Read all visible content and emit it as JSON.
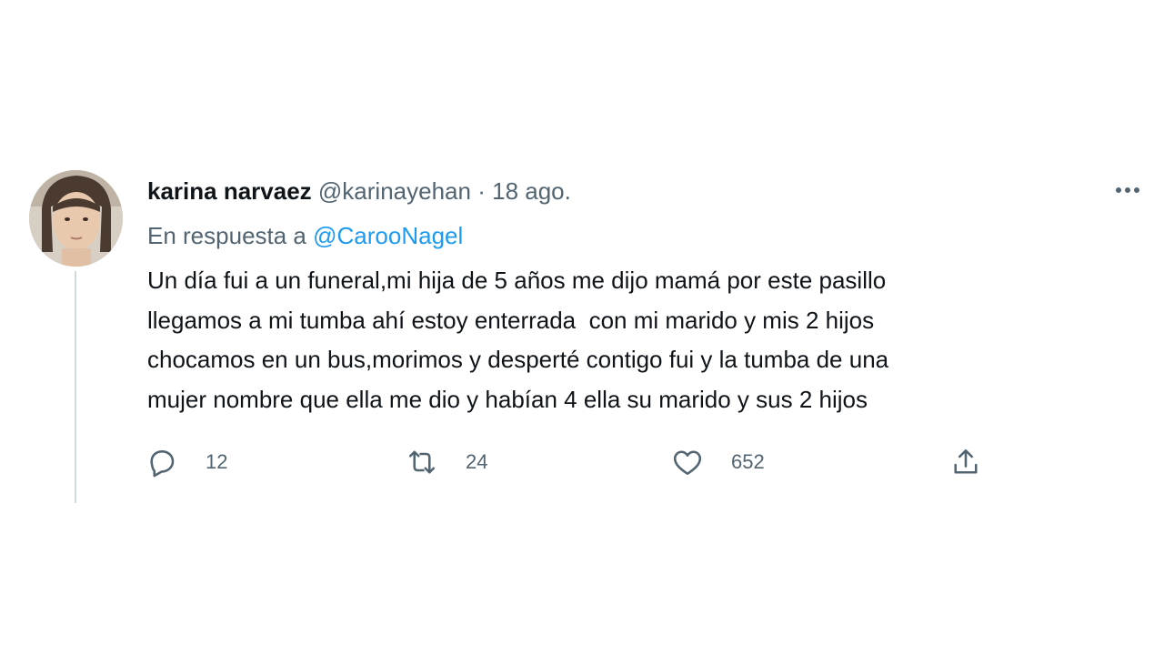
{
  "tweet": {
    "author": {
      "name": "karina narvaez",
      "handle": "@karinayehan",
      "separator": "·",
      "date": "18 ago."
    },
    "reply": {
      "prefix": "En respuesta a",
      "mention": "@CarooNagel"
    },
    "text_lines": [
      "Un día fui a un funeral,mi hija de 5 años me dijo mamá por este pasillo",
      "llegamos a mi tumba ahí estoy enterrada  con mi marido y mis 2 hijos",
      "chocamos en un bus,morimos y desperté contigo fui y la tumba de una",
      "mujer nombre que ella me dio y habían 4 ella su marido y sus 2 hijos"
    ],
    "actions": {
      "replies": "12",
      "retweets": "24",
      "likes": "652"
    }
  },
  "colors": {
    "text": "#0f1419",
    "secondary": "#536471",
    "link": "#1d9bf0",
    "thread_line": "#cfd9de"
  },
  "icons": [
    "reply-icon",
    "retweet-icon",
    "like-icon",
    "share-icon",
    "more-icon"
  ]
}
